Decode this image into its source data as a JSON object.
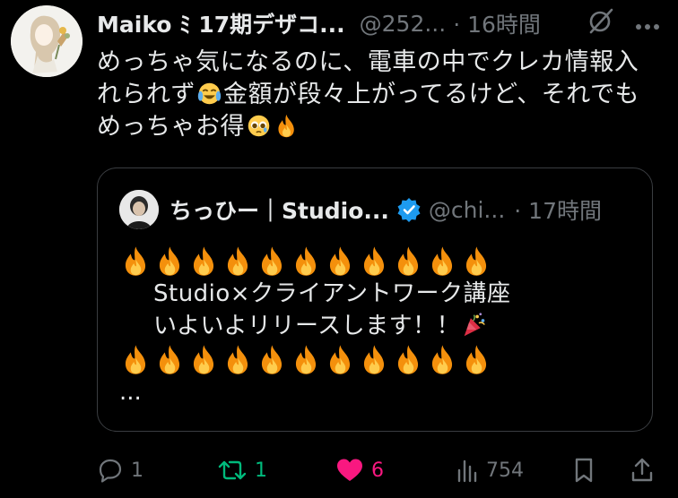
{
  "post": {
    "author_name": "Maiko ﾐ 17期デザコ...",
    "author_handle": "@252...",
    "time": "· 16時間",
    "text_part1": "めっちゃ気になるのに、電車の中でクレカ情報入れられず",
    "text_part2": "金額が段々上がってるけど、それでもめっちゃお得",
    "emoji_1": "face-with-tears-of-joy",
    "emoji_2": "pleading-face",
    "emoji_3": "fire"
  },
  "quote": {
    "author_name": "ちっひー｜Studio...",
    "author_handle": "@chi...",
    "time": "· 17時間",
    "verified_color": "#1d9bf0",
    "fire_row_count": 11,
    "line1": "Studio×クライアントワーク講座",
    "line2": "いよいよリリースします！！",
    "line2_emoji": "party-popper",
    "ellipsis": "..."
  },
  "actions": {
    "reply_count": "1",
    "repost_count": "1",
    "like_count": "6",
    "view_count": "754"
  },
  "colors": {
    "background": "#000000",
    "text": "#e7e9ea",
    "muted": "#71767b",
    "repost": "#00ba7c",
    "like": "#f91880",
    "border": "#3a3d41"
  }
}
